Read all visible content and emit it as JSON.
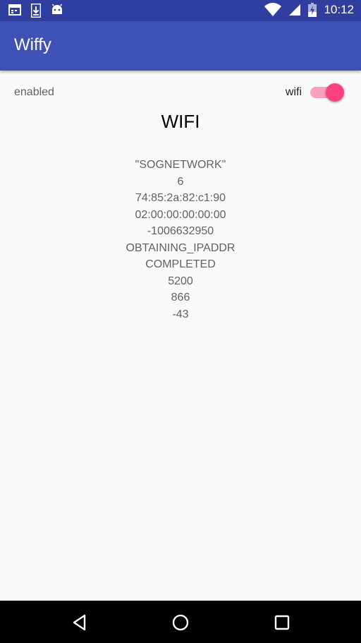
{
  "status_bar": {
    "time": "10:12",
    "left_icons": [
      "calendar-icon",
      "download-icon",
      "android-icon"
    ],
    "right_icons": [
      "wifi-signal-icon",
      "cell-signal-icon",
      "battery-charging-icon"
    ]
  },
  "app_bar": {
    "title": "Wiffy",
    "color": "#3f51b5",
    "status_color": "#303f9f"
  },
  "main": {
    "status_text": "enabled",
    "switch_label": "wifi",
    "switch_on": true,
    "accent_color": "#ff4081",
    "heading": "WIFI",
    "info_lines": [
      "\"SOGNETWORK\"",
      "6",
      "74:85:2a:82:c1:90",
      "02:00:00:00:00:00",
      "-1006632950",
      "OBTAINING_IPADDR",
      "COMPLETED",
      "5200",
      "866",
      "-43"
    ]
  },
  "nav_bar": {
    "buttons": [
      "back-icon",
      "home-icon",
      "recents-icon"
    ]
  }
}
